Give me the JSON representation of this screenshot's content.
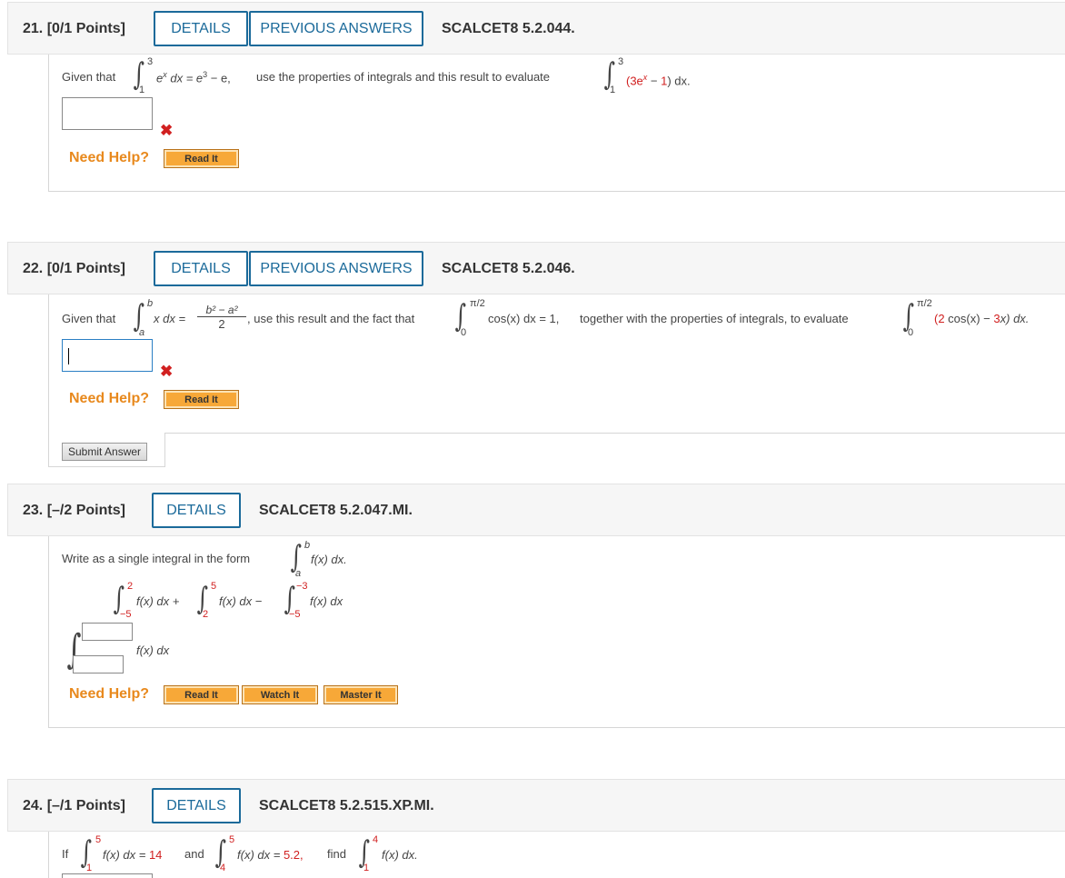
{
  "common": {
    "details": "DETAILS",
    "previous_answers": "PREVIOUS ANSWERS",
    "need_help": "Need Help?",
    "read_it": "Read It",
    "watch_it": "Watch It",
    "master_it": "Master It",
    "submit": "Submit Answer",
    "int_sign": "∫",
    "cross": "✖"
  },
  "q21": {
    "num": "21.  [0/1 Points]",
    "id": "SCALCET8 5.2.044.",
    "given": "Given that",
    "ub1": "3",
    "lb1": "1",
    "integrand1": "e",
    "integrand1_sup": "x",
    "dx_eq": " dx = e",
    "sup3": "3",
    "rhs": " − e,",
    "text_mid": "use the properties of integrals and this result to evaluate",
    "ub2": "3",
    "lb2": "1",
    "expr_open": "(3e",
    "expr_sup": "x",
    "expr_minus": " − ",
    "expr_one": "1",
    "expr_close": ") dx."
  },
  "q22": {
    "num": "22.  [0/1 Points]",
    "id": "SCALCET8 5.2.046.",
    "given": "Given that",
    "ub1": "b",
    "lb1": "a",
    "integrand1": "x dx =",
    "frac_num": "b² − a²",
    "frac_den": "2",
    "text_mid": ", use this result and the fact that",
    "ub2": "π/2",
    "lb2": "0",
    "integrand2": "cos(x) dx = 1,",
    "text_end": "together with the properties of integrals, to evaluate",
    "ub3": "π/2",
    "lb3": "0",
    "expr_a": "(2",
    "expr_b": " cos(x) − ",
    "expr_c": "3",
    "expr_d": "x) dx."
  },
  "q23": {
    "num": "23.  [–/2 Points]",
    "id": "SCALCET8 5.2.047.MI.",
    "prompt": "Write as a single integral in the form",
    "form_ub": "b",
    "form_lb": "a",
    "form_integrand": "f(x) dx.",
    "i1_ub": "2",
    "i1_lb": "−5",
    "i1_text": "f(x) dx +",
    "i2_ub": "5",
    "i2_lb": "2",
    "i2_text": "f(x) dx −",
    "i3_ub": "−3",
    "i3_lb": "−5",
    "i3_text": "f(x) dx",
    "answer_text": "f(x) dx"
  },
  "q24": {
    "num": "24.  [–/1 Points]",
    "id": "SCALCET8 5.2.515.XP.MI.",
    "if": "If",
    "i1_ub": "5",
    "i1_lb": "1",
    "i1_text": "f(x) dx = ",
    "i1_val": "14",
    "and": "and",
    "i2_ub": "5",
    "i2_lb": "4",
    "i2_text": "f(x) dx = ",
    "i2_val": "5.2,",
    "find": "find",
    "i3_ub": "4",
    "i3_lb": "1",
    "i3_text": "f(x) dx."
  }
}
